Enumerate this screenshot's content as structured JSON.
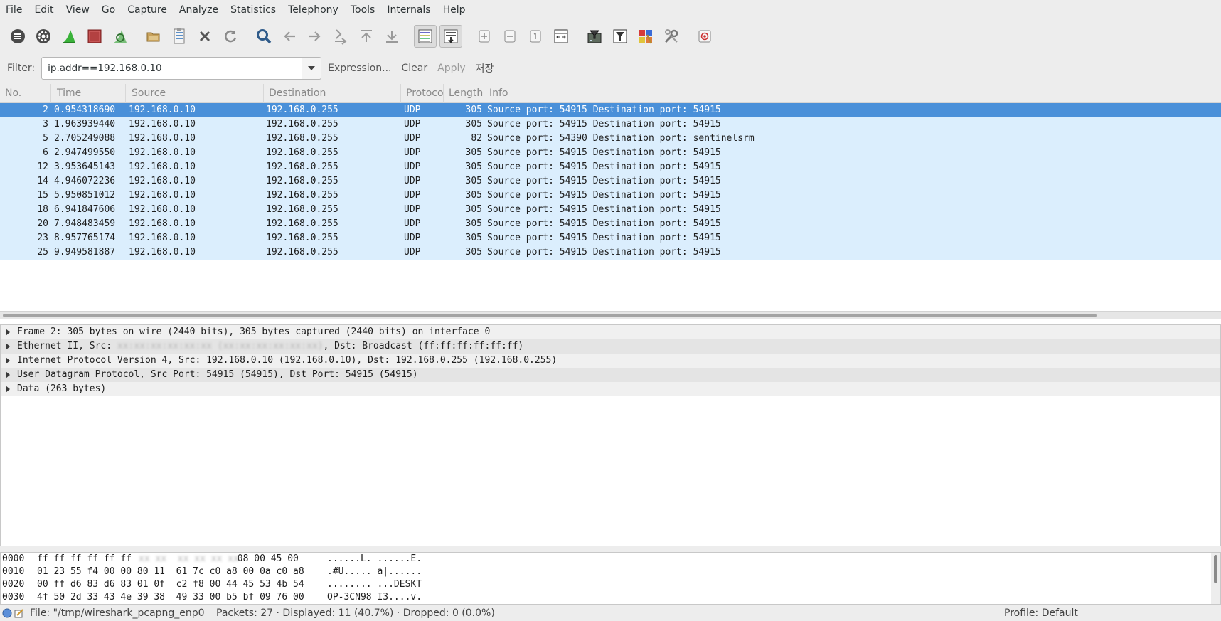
{
  "menu": [
    "File",
    "Edit",
    "View",
    "Go",
    "Capture",
    "Analyze",
    "Statistics",
    "Telephony",
    "Tools",
    "Internals",
    "Help"
  ],
  "toolbar": {
    "icons": [
      "interfaces-list-icon",
      "capture-options-icon",
      "start-capture-icon",
      "stop-capture-icon",
      "restart-capture-icon",
      "open-file-icon",
      "save-file-icon",
      "close-file-icon",
      "reload-icon",
      "find-packet-icon",
      "go-back-icon",
      "go-forward-icon",
      "go-to-packet-icon",
      "first-packet-icon",
      "last-packet-icon",
      "colorize-icon",
      "autoscroll-icon",
      "zoom-in-icon",
      "zoom-out-icon",
      "normal-size-icon",
      "resize-columns-icon",
      "capture-filters-icon",
      "display-filters-icon",
      "coloring-rules-icon",
      "preferences-icon",
      "help-icon"
    ]
  },
  "filter": {
    "label": "Filter:",
    "value": "ip.addr==192.168.0.10",
    "expression": "Expression...",
    "clear": "Clear",
    "apply": "Apply",
    "save": "저장"
  },
  "columns": [
    "No.",
    "Time",
    "Source",
    "Destination",
    "Protocol",
    "Length",
    "Info"
  ],
  "packets": [
    {
      "no": "2",
      "time": "0.954318690",
      "src": "192.168.0.10",
      "dst": "192.168.0.255",
      "proto": "UDP",
      "len": "305",
      "info": "Source port: 54915  Destination port: 54915"
    },
    {
      "no": "3",
      "time": "1.963939440",
      "src": "192.168.0.10",
      "dst": "192.168.0.255",
      "proto": "UDP",
      "len": "305",
      "info": "Source port: 54915  Destination port: 54915"
    },
    {
      "no": "5",
      "time": "2.705249088",
      "src": "192.168.0.10",
      "dst": "192.168.0.255",
      "proto": "UDP",
      "len": "82",
      "info": "Source port: 54390  Destination port: sentinelsrm"
    },
    {
      "no": "6",
      "time": "2.947499550",
      "src": "192.168.0.10",
      "dst": "192.168.0.255",
      "proto": "UDP",
      "len": "305",
      "info": "Source port: 54915  Destination port: 54915"
    },
    {
      "no": "12",
      "time": "3.953645143",
      "src": "192.168.0.10",
      "dst": "192.168.0.255",
      "proto": "UDP",
      "len": "305",
      "info": "Source port: 54915  Destination port: 54915"
    },
    {
      "no": "14",
      "time": "4.946072236",
      "src": "192.168.0.10",
      "dst": "192.168.0.255",
      "proto": "UDP",
      "len": "305",
      "info": "Source port: 54915  Destination port: 54915"
    },
    {
      "no": "15",
      "time": "5.950851012",
      "src": "192.168.0.10",
      "dst": "192.168.0.255",
      "proto": "UDP",
      "len": "305",
      "info": "Source port: 54915  Destination port: 54915"
    },
    {
      "no": "18",
      "time": "6.941847606",
      "src": "192.168.0.10",
      "dst": "192.168.0.255",
      "proto": "UDP",
      "len": "305",
      "info": "Source port: 54915  Destination port: 54915"
    },
    {
      "no": "20",
      "time": "7.948483459",
      "src": "192.168.0.10",
      "dst": "192.168.0.255",
      "proto": "UDP",
      "len": "305",
      "info": "Source port: 54915  Destination port: 54915"
    },
    {
      "no": "23",
      "time": "8.957765174",
      "src": "192.168.0.10",
      "dst": "192.168.0.255",
      "proto": "UDP",
      "len": "305",
      "info": "Source port: 54915  Destination port: 54915"
    },
    {
      "no": "25",
      "time": "9.949581887",
      "src": "192.168.0.10",
      "dst": "192.168.0.255",
      "proto": "UDP",
      "len": "305",
      "info": "Source port: 54915  Destination port: 54915"
    }
  ],
  "selected_packet": "2",
  "details": {
    "frame": "Frame 2: 305 bytes on wire (2440 bits), 305 bytes captured (2440 bits) on interface 0",
    "ethernet_prefix": "Ethernet II, Src: ",
    "ethernet_suffix": ", Dst: Broadcast (ff:ff:ff:ff:ff:ff)",
    "ip": "Internet Protocol Version 4, Src: 192.168.0.10 (192.168.0.10), Dst: 192.168.0.255 (192.168.0.255)",
    "udp": "User Datagram Protocol, Src Port: 54915 (54915), Dst Port: 54915 (54915)",
    "data": "Data (263 bytes)"
  },
  "hex": [
    {
      "offset": "0000",
      "bytes": "ff ff ff ff ff ff                   08 00 45 00",
      "ascii": "......L. ......E."
    },
    {
      "offset": "0010",
      "bytes": "01 23 55 f4 00 00 80 11  61 7c c0 a8 00 0a c0 a8",
      "ascii": ".#U..... a|......"
    },
    {
      "offset": "0020",
      "bytes": "00 ff d6 83 d6 83 01 0f  c2 f8 00 44 45 53 4b 54",
      "ascii": "........ ...DESKT"
    },
    {
      "offset": "0030",
      "bytes": "4f 50 2d 33 43 4e 39 38  49 33 00 b5 bf 09 76 00",
      "ascii": "OP-3CN98 I3....v."
    }
  ],
  "status": {
    "file": "File: \"/tmp/wireshark_pcapng_enp0…",
    "packets": "Packets: 27 · Displayed: 11 (40.7%) · Dropped: 0 (0.0%)",
    "profile": "Profile: Default"
  }
}
